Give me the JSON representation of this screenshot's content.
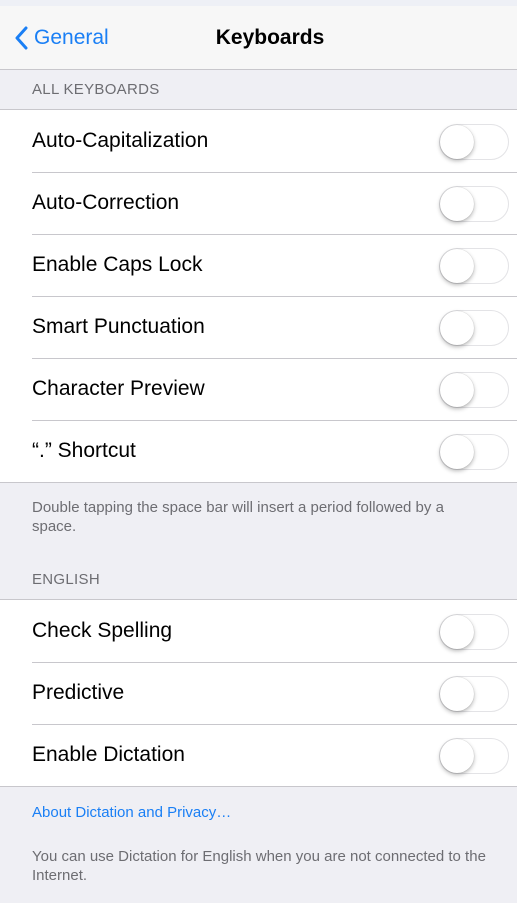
{
  "nav": {
    "back_label": "General",
    "title": "Keyboards"
  },
  "all_keyboards": {
    "header": "ALL KEYBOARDS",
    "items": [
      {
        "label": "Auto-Capitalization",
        "on": false
      },
      {
        "label": "Auto-Correction",
        "on": false
      },
      {
        "label": "Enable Caps Lock",
        "on": false
      },
      {
        "label": "Smart Punctuation",
        "on": false
      },
      {
        "label": "Character Preview",
        "on": false
      },
      {
        "label": "“.” Shortcut",
        "on": false
      }
    ],
    "footer": "Double tapping the space bar will insert a period followed by a space."
  },
  "english": {
    "header": "ENGLISH",
    "items": [
      {
        "label": "Check Spelling",
        "on": false
      },
      {
        "label": "Predictive",
        "on": false
      },
      {
        "label": "Enable Dictation",
        "on": false
      }
    ],
    "link": "About Dictation and Privacy…",
    "footer": "You can use Dictation for English when you are not connected to the Internet."
  },
  "colors": {
    "accent": "#1a7ff5",
    "background": "#efeff4",
    "separator": "#c8c7cc",
    "secondary_text": "#6d6d72"
  }
}
